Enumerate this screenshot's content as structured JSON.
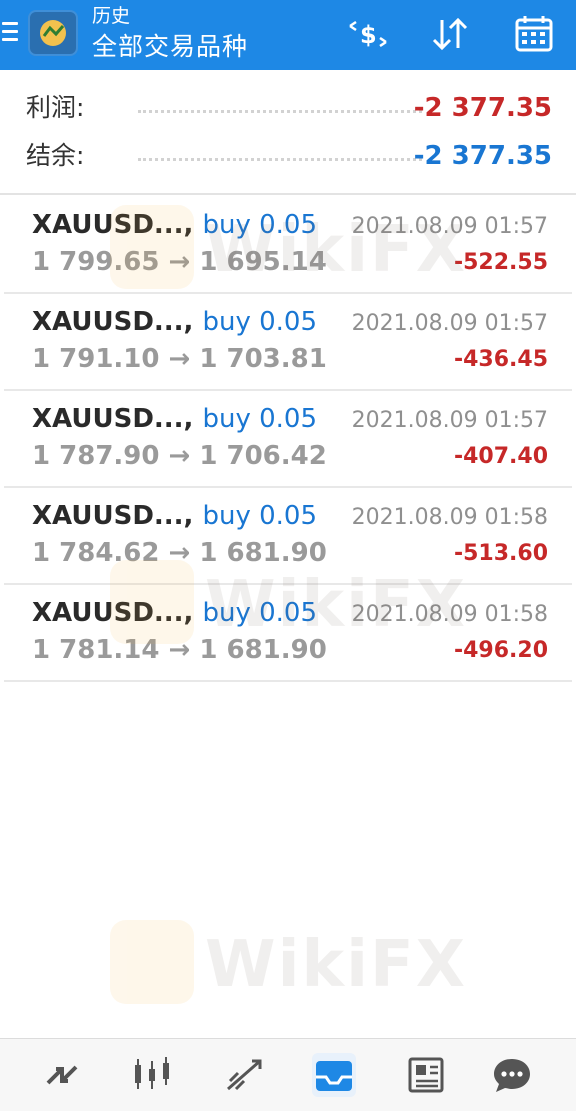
{
  "header": {
    "subtitle": "历史",
    "title": "全部交易品种"
  },
  "summary": {
    "profit_label": "利润:",
    "profit_value": "-2 377.35",
    "balance_label": "结余:",
    "balance_value": "-2 377.35"
  },
  "deals": [
    {
      "symbol": "XAUUSD...,",
      "side": "buy 0.05",
      "prices": "1 799.65 → 1 695.14",
      "time": "2021.08.09 01:57",
      "profit": "-522.55"
    },
    {
      "symbol": "XAUUSD...,",
      "side": "buy 0.05",
      "prices": "1 791.10 → 1 703.81",
      "time": "2021.08.09 01:57",
      "profit": "-436.45"
    },
    {
      "symbol": "XAUUSD...,",
      "side": "buy 0.05",
      "prices": "1 787.90 → 1 706.42",
      "time": "2021.08.09 01:57",
      "profit": "-407.40"
    },
    {
      "symbol": "XAUUSD...,",
      "side": "buy 0.05",
      "prices": "1 784.62 → 1 681.90",
      "time": "2021.08.09 01:58",
      "profit": "-513.60"
    },
    {
      "symbol": "XAUUSD...,",
      "side": "buy 0.05",
      "prices": "1 781.14 → 1 681.90",
      "time": "2021.08.09 01:58",
      "profit": "-496.20"
    }
  ],
  "watermark": {
    "text": "WikiFX"
  },
  "colors": {
    "header_bg": "#1e88e5",
    "loss_red": "#c62828",
    "balance_blue": "#1976d2",
    "side_blue": "#1976d2"
  },
  "icons": {
    "header": [
      "menu-icon",
      "app-logo-icon",
      "currency-exchange-icon",
      "sort-icon",
      "calendar-icon"
    ],
    "bottom_nav": [
      "quotes-icon",
      "chart-icon",
      "trade-icon",
      "history-icon",
      "news-icon",
      "chat-icon"
    ]
  },
  "active_nav": "history-icon"
}
